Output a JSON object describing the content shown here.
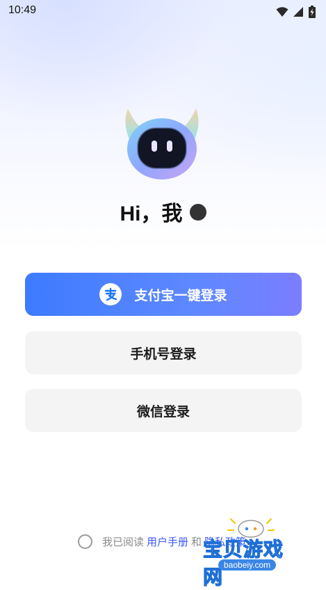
{
  "status_bar": {
    "time": "10:49"
  },
  "greeting": {
    "text": "Hi，我"
  },
  "buttons": {
    "alipay": "支付宝一键登录",
    "phone": "手机号登录",
    "wechat": "微信登录"
  },
  "agreement": {
    "prefix": "我已阅读",
    "user_manual": "用户手册",
    "and": "和",
    "privacy_policy": "隐私政策"
  },
  "watermark": {
    "title": "宝贝游戏网",
    "url": "baobeiy.com"
  },
  "colors": {
    "alipay_gradient_start": "#3d7bff",
    "alipay_gradient_end": "#7b7dff",
    "link": "#3b58ff",
    "secondary_button_bg": "#f4f4f5"
  }
}
